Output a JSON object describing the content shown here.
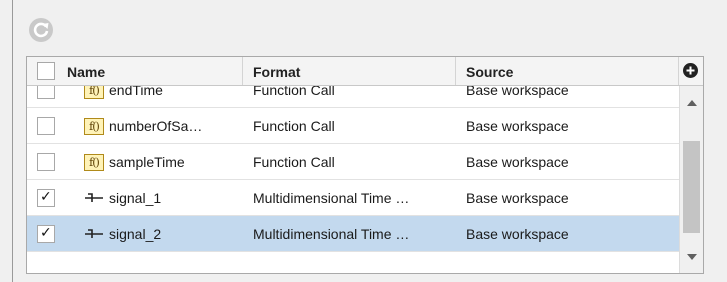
{
  "toolbar": {
    "refresh_icon": "refresh-icon"
  },
  "table": {
    "columns": [
      "Name",
      "Format",
      "Source"
    ],
    "rows": [
      {
        "checked": false,
        "icon": "function-icon",
        "icon_text": "f()",
        "name": "endTime",
        "format": "Function Call",
        "source": "Base workspace",
        "selected": false
      },
      {
        "checked": false,
        "icon": "function-icon",
        "icon_text": "f()",
        "name": "numberOfSa…",
        "format": "Function Call",
        "source": "Base workspace",
        "selected": false
      },
      {
        "checked": false,
        "icon": "function-icon",
        "icon_text": "f()",
        "name": "sampleTime",
        "format": "Function Call",
        "source": "Base workspace",
        "selected": false
      },
      {
        "checked": true,
        "icon": "signal-icon",
        "icon_text": "",
        "name": "signal_1",
        "format": "Multidimensional Time …",
        "source": "Base workspace",
        "selected": false
      },
      {
        "checked": true,
        "icon": "signal-icon",
        "icon_text": "",
        "name": "signal_2",
        "format": "Multidimensional Time …",
        "source": "Base workspace",
        "selected": true
      }
    ],
    "add_column_icon": "plus-circle-icon"
  },
  "colors": {
    "selection": "#c3d9ee",
    "background": "#f0f0f0"
  }
}
